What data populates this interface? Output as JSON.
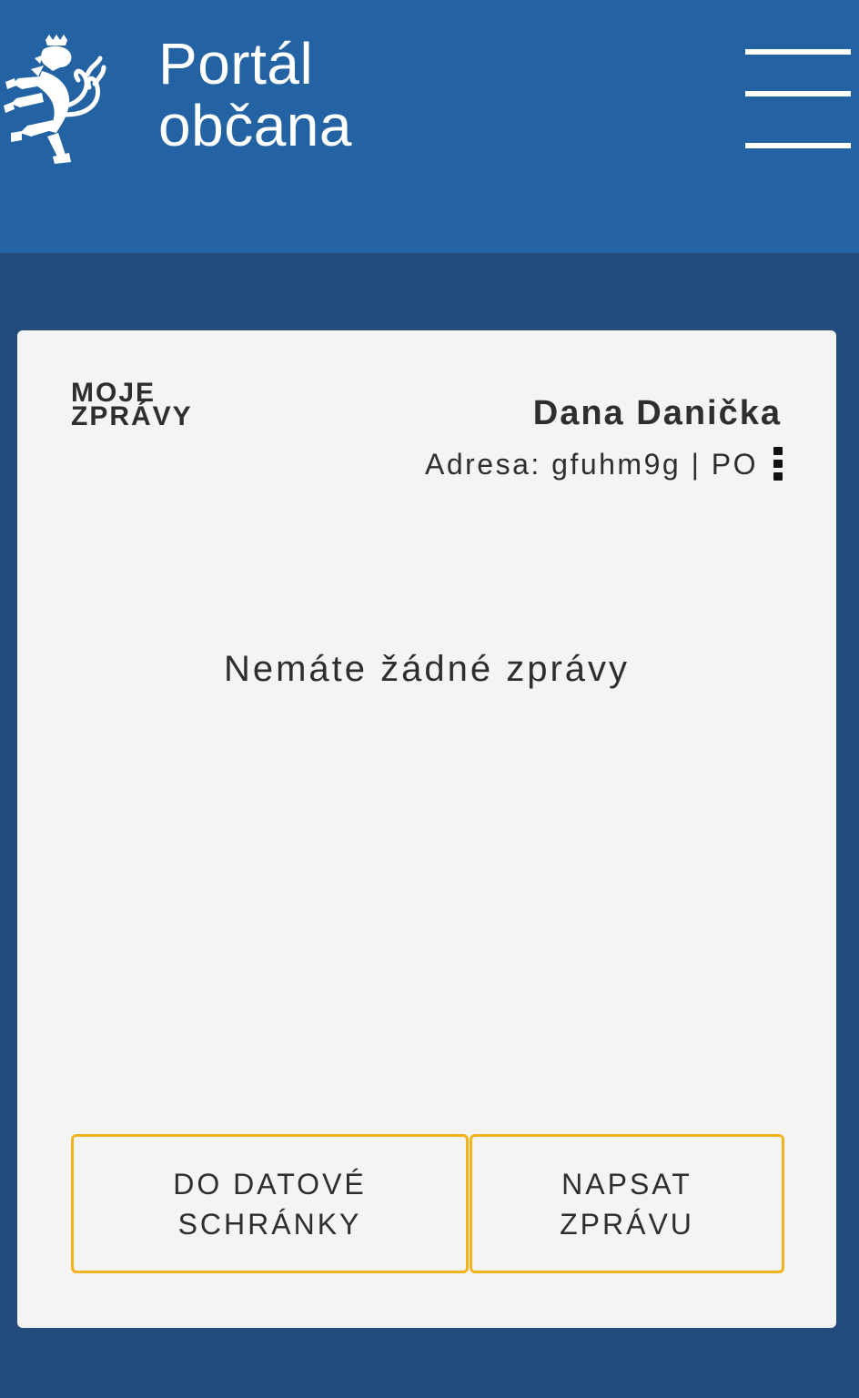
{
  "header": {
    "title_line1": "Portál",
    "title_line2": "občana",
    "logo_icon": "czech-lion-emblem-icon",
    "menu_icon": "hamburger-menu-icon"
  },
  "messages": {
    "section_title_line1": "MOJE",
    "section_title_line2": "ZPRÁVY",
    "user_name": "Dana Danička",
    "user_address": "Adresa: gfuhm9g | PO",
    "more_icon": "more-vertical-icon",
    "empty_text": "Nemáte žádné zprávy",
    "btn_datova": "DO DATOVÉ\nSCHRÁNKY",
    "btn_napsat": "NAPSAT\nZPRÁVU"
  },
  "colors": {
    "header_bg": "#2463a3",
    "page_bg": "#234c7c",
    "card_bg": "#f4f4f4",
    "button_border": "#f2b21c"
  }
}
